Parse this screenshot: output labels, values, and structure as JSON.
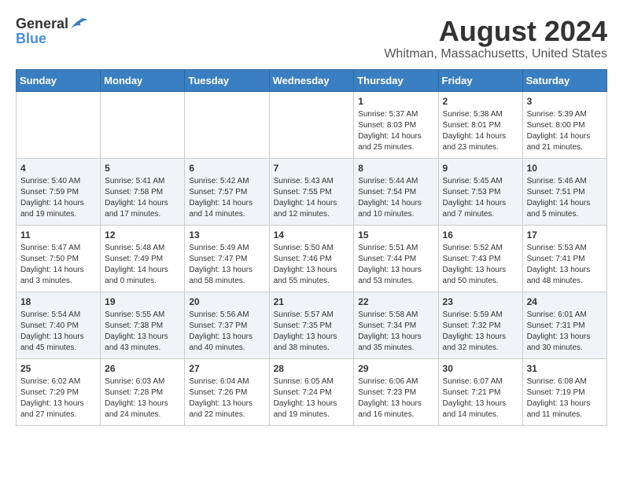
{
  "logo": {
    "general": "General",
    "blue": "Blue"
  },
  "header": {
    "month": "August 2024",
    "location": "Whitman, Massachusetts, United States"
  },
  "weekdays": [
    "Sunday",
    "Monday",
    "Tuesday",
    "Wednesday",
    "Thursday",
    "Friday",
    "Saturday"
  ],
  "weeks": [
    [
      {
        "day": "",
        "info": ""
      },
      {
        "day": "",
        "info": ""
      },
      {
        "day": "",
        "info": ""
      },
      {
        "day": "",
        "info": ""
      },
      {
        "day": "1",
        "info": "Sunrise: 5:37 AM\nSunset: 8:03 PM\nDaylight: 14 hours\nand 25 minutes."
      },
      {
        "day": "2",
        "info": "Sunrise: 5:38 AM\nSunset: 8:01 PM\nDaylight: 14 hours\nand 23 minutes."
      },
      {
        "day": "3",
        "info": "Sunrise: 5:39 AM\nSunset: 8:00 PM\nDaylight: 14 hours\nand 21 minutes."
      }
    ],
    [
      {
        "day": "4",
        "info": "Sunrise: 5:40 AM\nSunset: 7:59 PM\nDaylight: 14 hours\nand 19 minutes."
      },
      {
        "day": "5",
        "info": "Sunrise: 5:41 AM\nSunset: 7:58 PM\nDaylight: 14 hours\nand 17 minutes."
      },
      {
        "day": "6",
        "info": "Sunrise: 5:42 AM\nSunset: 7:57 PM\nDaylight: 14 hours\nand 14 minutes."
      },
      {
        "day": "7",
        "info": "Sunrise: 5:43 AM\nSunset: 7:55 PM\nDaylight: 14 hours\nand 12 minutes."
      },
      {
        "day": "8",
        "info": "Sunrise: 5:44 AM\nSunset: 7:54 PM\nDaylight: 14 hours\nand 10 minutes."
      },
      {
        "day": "9",
        "info": "Sunrise: 5:45 AM\nSunset: 7:53 PM\nDaylight: 14 hours\nand 7 minutes."
      },
      {
        "day": "10",
        "info": "Sunrise: 5:46 AM\nSunset: 7:51 PM\nDaylight: 14 hours\nand 5 minutes."
      }
    ],
    [
      {
        "day": "11",
        "info": "Sunrise: 5:47 AM\nSunset: 7:50 PM\nDaylight: 14 hours\nand 3 minutes."
      },
      {
        "day": "12",
        "info": "Sunrise: 5:48 AM\nSunset: 7:49 PM\nDaylight: 14 hours\nand 0 minutes."
      },
      {
        "day": "13",
        "info": "Sunrise: 5:49 AM\nSunset: 7:47 PM\nDaylight: 13 hours\nand 58 minutes."
      },
      {
        "day": "14",
        "info": "Sunrise: 5:50 AM\nSunset: 7:46 PM\nDaylight: 13 hours\nand 55 minutes."
      },
      {
        "day": "15",
        "info": "Sunrise: 5:51 AM\nSunset: 7:44 PM\nDaylight: 13 hours\nand 53 minutes."
      },
      {
        "day": "16",
        "info": "Sunrise: 5:52 AM\nSunset: 7:43 PM\nDaylight: 13 hours\nand 50 minutes."
      },
      {
        "day": "17",
        "info": "Sunrise: 5:53 AM\nSunset: 7:41 PM\nDaylight: 13 hours\nand 48 minutes."
      }
    ],
    [
      {
        "day": "18",
        "info": "Sunrise: 5:54 AM\nSunset: 7:40 PM\nDaylight: 13 hours\nand 45 minutes."
      },
      {
        "day": "19",
        "info": "Sunrise: 5:55 AM\nSunset: 7:38 PM\nDaylight: 13 hours\nand 43 minutes."
      },
      {
        "day": "20",
        "info": "Sunrise: 5:56 AM\nSunset: 7:37 PM\nDaylight: 13 hours\nand 40 minutes."
      },
      {
        "day": "21",
        "info": "Sunrise: 5:57 AM\nSunset: 7:35 PM\nDaylight: 13 hours\nand 38 minutes."
      },
      {
        "day": "22",
        "info": "Sunrise: 5:58 AM\nSunset: 7:34 PM\nDaylight: 13 hours\nand 35 minutes."
      },
      {
        "day": "23",
        "info": "Sunrise: 5:59 AM\nSunset: 7:32 PM\nDaylight: 13 hours\nand 32 minutes."
      },
      {
        "day": "24",
        "info": "Sunrise: 6:01 AM\nSunset: 7:31 PM\nDaylight: 13 hours\nand 30 minutes."
      }
    ],
    [
      {
        "day": "25",
        "info": "Sunrise: 6:02 AM\nSunset: 7:29 PM\nDaylight: 13 hours\nand 27 minutes."
      },
      {
        "day": "26",
        "info": "Sunrise: 6:03 AM\nSunset: 7:28 PM\nDaylight: 13 hours\nand 24 minutes."
      },
      {
        "day": "27",
        "info": "Sunrise: 6:04 AM\nSunset: 7:26 PM\nDaylight: 13 hours\nand 22 minutes."
      },
      {
        "day": "28",
        "info": "Sunrise: 6:05 AM\nSunset: 7:24 PM\nDaylight: 13 hours\nand 19 minutes."
      },
      {
        "day": "29",
        "info": "Sunrise: 6:06 AM\nSunset: 7:23 PM\nDaylight: 13 hours\nand 16 minutes."
      },
      {
        "day": "30",
        "info": "Sunrise: 6:07 AM\nSunset: 7:21 PM\nDaylight: 13 hours\nand 14 minutes."
      },
      {
        "day": "31",
        "info": "Sunrise: 6:08 AM\nSunset: 7:19 PM\nDaylight: 13 hours\nand 11 minutes."
      }
    ]
  ]
}
